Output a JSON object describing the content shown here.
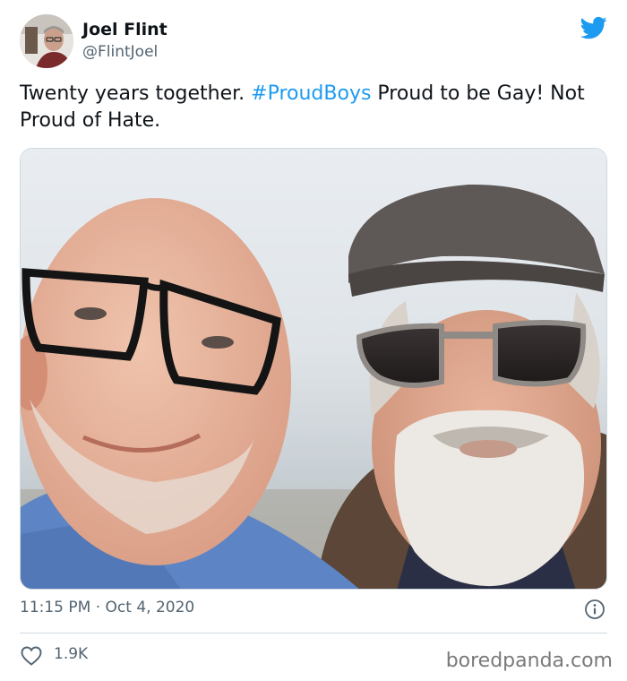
{
  "author": {
    "name": "Joel Flint",
    "handle": "@FlintJoel"
  },
  "tweet": {
    "text_before": "Twenty years together. ",
    "hashtag": "#ProudBoys",
    "text_after": " Proud to be Gay! Not Proud of Hate."
  },
  "meta": {
    "time": "11:15 PM",
    "separator": " · ",
    "date": "Oct 4, 2020"
  },
  "engagement": {
    "likes": "1.9K"
  },
  "watermark": "boredpanda.com",
  "icons": {
    "brand": "twitter-bird-icon",
    "info": "info-icon",
    "like": "heart-icon"
  },
  "colors": {
    "link": "#1d9bf0",
    "secondary_text": "#536471",
    "primary_text": "#0f1419",
    "twitter_blue": "#1d9bf0"
  }
}
